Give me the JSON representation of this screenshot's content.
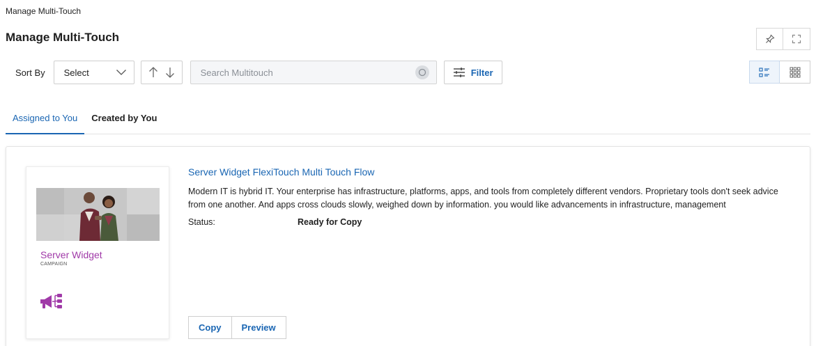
{
  "breadcrumb": "Manage Multi-Touch",
  "page_title": "Manage Multi-Touch",
  "toolbar": {
    "sort_label": "Sort By",
    "sort_value": "Select",
    "search_placeholder": "Search Multitouch",
    "filter_label": "Filter"
  },
  "tabs": [
    {
      "label": "Assigned to You",
      "active": true
    },
    {
      "label": "Created by You",
      "active": false
    }
  ],
  "card": {
    "thumbnail_name": "Server Widget",
    "thumbnail_type": "CAMPAIGN",
    "title": "Server Widget FlexiTouch Multi Touch Flow",
    "description": "Modern IT is hybrid IT. Your enterprise has infrastructure, platforms, apps, and tools from completely different vendors. Proprietary tools don't seek advice from one another. And apps cross clouds slowly, weighed down by information. you would like advancements in infrastructure, management",
    "status_label": "Status:",
    "status_value": "Ready for Copy",
    "copy_label": "Copy",
    "preview_label": "Preview"
  },
  "icons": {
    "pin": "pin-icon",
    "fullscreen": "fullscreen-icon",
    "chevron": "chevron-down-icon",
    "sort": "sort-arrows-icon",
    "search": "search-icon",
    "filter": "filter-sliders-icon",
    "list_view": "list-view-icon",
    "grid_view": "grid-view-icon",
    "campaign": "megaphone-flow-icon"
  },
  "colors": {
    "accent": "#1a66b3",
    "campaign": "#a03aa8"
  }
}
